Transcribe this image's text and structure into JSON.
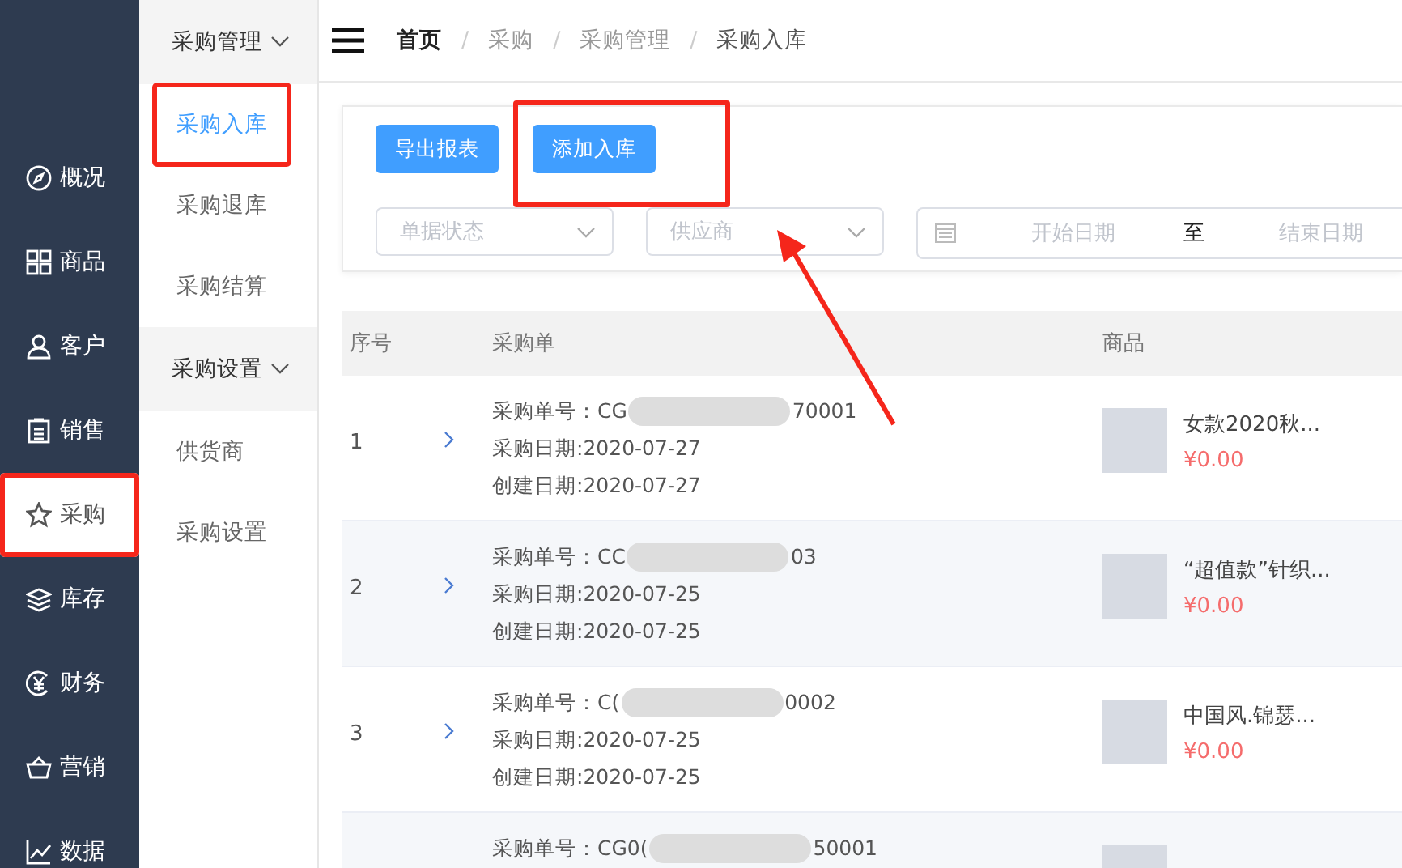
{
  "nav": [
    {
      "label": "概况",
      "selected": false,
      "highlighted": false
    },
    {
      "label": "商品",
      "selected": false,
      "highlighted": false
    },
    {
      "label": "客户",
      "selected": false,
      "highlighted": false
    },
    {
      "label": "销售",
      "selected": false,
      "highlighted": false
    },
    {
      "label": "采购",
      "selected": true,
      "highlighted": true
    },
    {
      "label": "库存",
      "selected": false,
      "highlighted": false
    },
    {
      "label": "财务",
      "selected": false,
      "highlighted": false
    },
    {
      "label": "营销",
      "selected": false,
      "highlighted": false
    },
    {
      "label": "数据",
      "selected": false,
      "highlighted": false
    }
  ],
  "submenu": [
    {
      "title": "采购管理",
      "expanded": true,
      "items": [
        {
          "label": "采购入库",
          "selected": true,
          "highlighted": true
        },
        {
          "label": "采购退库",
          "selected": false,
          "highlighted": false
        },
        {
          "label": "采购结算",
          "selected": false,
          "highlighted": false
        }
      ]
    },
    {
      "title": "采购设置",
      "expanded": true,
      "items": [
        {
          "label": "供货商",
          "selected": false,
          "highlighted": false
        },
        {
          "label": "采购设置",
          "selected": false,
          "highlighted": false
        }
      ]
    }
  ],
  "breadcrumb": [
    {
      "label": "首页",
      "kind": "home"
    },
    {
      "separator": "/",
      "label": "采购",
      "kind": "link"
    },
    {
      "separator": "/",
      "label": "采购管理",
      "kind": "link"
    },
    {
      "separator": "/",
      "label": "采购入库",
      "kind": "current"
    }
  ],
  "toolbar": {
    "buttons": [
      {
        "label": "导出报表",
        "highlighted": false
      },
      {
        "label": "添加入库",
        "highlighted": true
      }
    ],
    "filters": [
      {
        "kind": "select",
        "placeholder": "单据状态"
      },
      {
        "kind": "select",
        "placeholder": "供应商"
      },
      {
        "kind": "daterange",
        "start_placeholder": "开始日期",
        "separator": "至",
        "end_placeholder": "结束日期"
      }
    ]
  },
  "table": {
    "columns": [
      "序号",
      "采购单",
      "商品"
    ],
    "rows": [
      {
        "index": "1",
        "order_prefix": "采购单号：CG",
        "order_suffix": "70001",
        "purchase_date": "采购日期:2020-07-27",
        "created_date": "创建日期:2020-07-27",
        "product": "女款2020秋...",
        "price": "¥0.00"
      },
      {
        "index": "2",
        "order_prefix": "采购单号：CC",
        "order_suffix": "03",
        "purchase_date": "采购日期:2020-07-25",
        "created_date": "创建日期:2020-07-25",
        "product": "“超值款”针织...",
        "price": "¥0.00"
      },
      {
        "index": "3",
        "order_prefix": "采购单号：C(",
        "order_suffix": "0002",
        "purchase_date": "采购日期:2020-07-25",
        "created_date": "创建日期:2020-07-25",
        "product": "中国风.锦瑟...",
        "price": "¥0.00"
      },
      {
        "index": "",
        "order_prefix": "采购单号：CG0(",
        "order_suffix": "50001"
      }
    ]
  }
}
